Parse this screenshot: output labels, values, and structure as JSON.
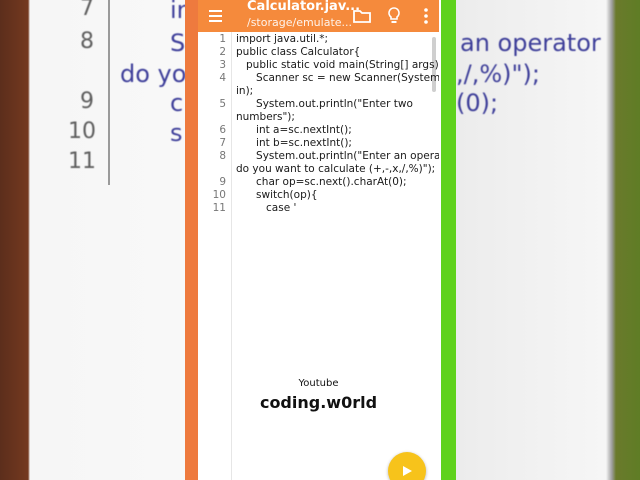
{
  "background": {
    "left_numbers": [
      "7",
      "8",
      "9",
      "10",
      "11"
    ],
    "left_fragments": [
      "in",
      "S",
      "c",
      "s"
    ],
    "left_code_line": "do you",
    "right_fragments": [
      "an operator",
      ",/,%)\");",
      "(0);"
    ]
  },
  "toolbar": {
    "title": "Calculator.jav...",
    "subtitle": "/storage/emulate...",
    "icons": [
      "menu-icon",
      "folder-icon",
      "lightbulb-icon",
      "more-vert-icon"
    ]
  },
  "editor": {
    "lines": [
      {
        "num": "1",
        "text": "import java.util.*;"
      },
      {
        "num": "2",
        "text": "public class Calculator{"
      },
      {
        "num": "3",
        "text": "   public static void main(String[] args) {"
      },
      {
        "num": "4",
        "text": "      Scanner sc = new Scanner(System."
      },
      {
        "num": "",
        "text": "in);"
      },
      {
        "num": "5",
        "text": "      System.out.println(\"Enter two"
      },
      {
        "num": "",
        "text": "numbers\");"
      },
      {
        "num": "6",
        "text": "      int a=sc.nextInt();"
      },
      {
        "num": "7",
        "text": "      int b=sc.nextInt();"
      },
      {
        "num": "8",
        "text": "      System.out.println(\"Enter an operator"
      },
      {
        "num": "",
        "text": "do you want to calculate (+,-,x,/,%)\");"
      },
      {
        "num": "9",
        "text": "      char op=sc.next().charAt(0);"
      },
      {
        "num": "10",
        "text": "      switch(op){"
      },
      {
        "num": "11",
        "text": "         case '"
      }
    ]
  },
  "watermark": {
    "label": "Youtube",
    "brand": "coding.w0rld"
  },
  "fab": {
    "icon": "play-icon"
  },
  "colors": {
    "toolbar": "#f58a3c",
    "frame_left": "#ee7a3e",
    "frame_right": "#5fd21c",
    "fab": "#f7c31b"
  }
}
